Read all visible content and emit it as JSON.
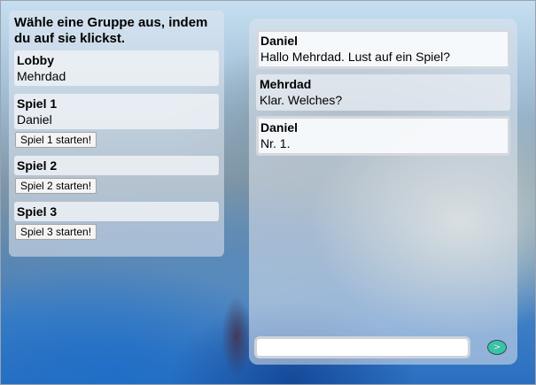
{
  "groups_panel": {
    "title": "Wähle eine Gruppe aus, indem du auf sie klickst.",
    "groups": [
      {
        "name": "Lobby",
        "member": "Mehrdad",
        "button": ""
      },
      {
        "name": "Spiel 1",
        "member": "Daniel",
        "button": "Spiel 1 starten!"
      },
      {
        "name": "Spiel 2",
        "member": "",
        "button": "Spiel 2 starten!"
      },
      {
        "name": "Spiel 3",
        "member": "",
        "button": "Spiel 3 starten!"
      }
    ]
  },
  "chat": {
    "messages": [
      {
        "sender": "Daniel",
        "text": "Hallo Mehrdad. Lust auf ein Spiel?"
      },
      {
        "sender": "Mehrdad",
        "text": "Klar. Welches?"
      },
      {
        "sender": "Daniel",
        "text": "Nr. 1."
      }
    ],
    "input_value": "",
    "send_label": ">"
  },
  "colors": {
    "send_button": "#35c6a8"
  }
}
